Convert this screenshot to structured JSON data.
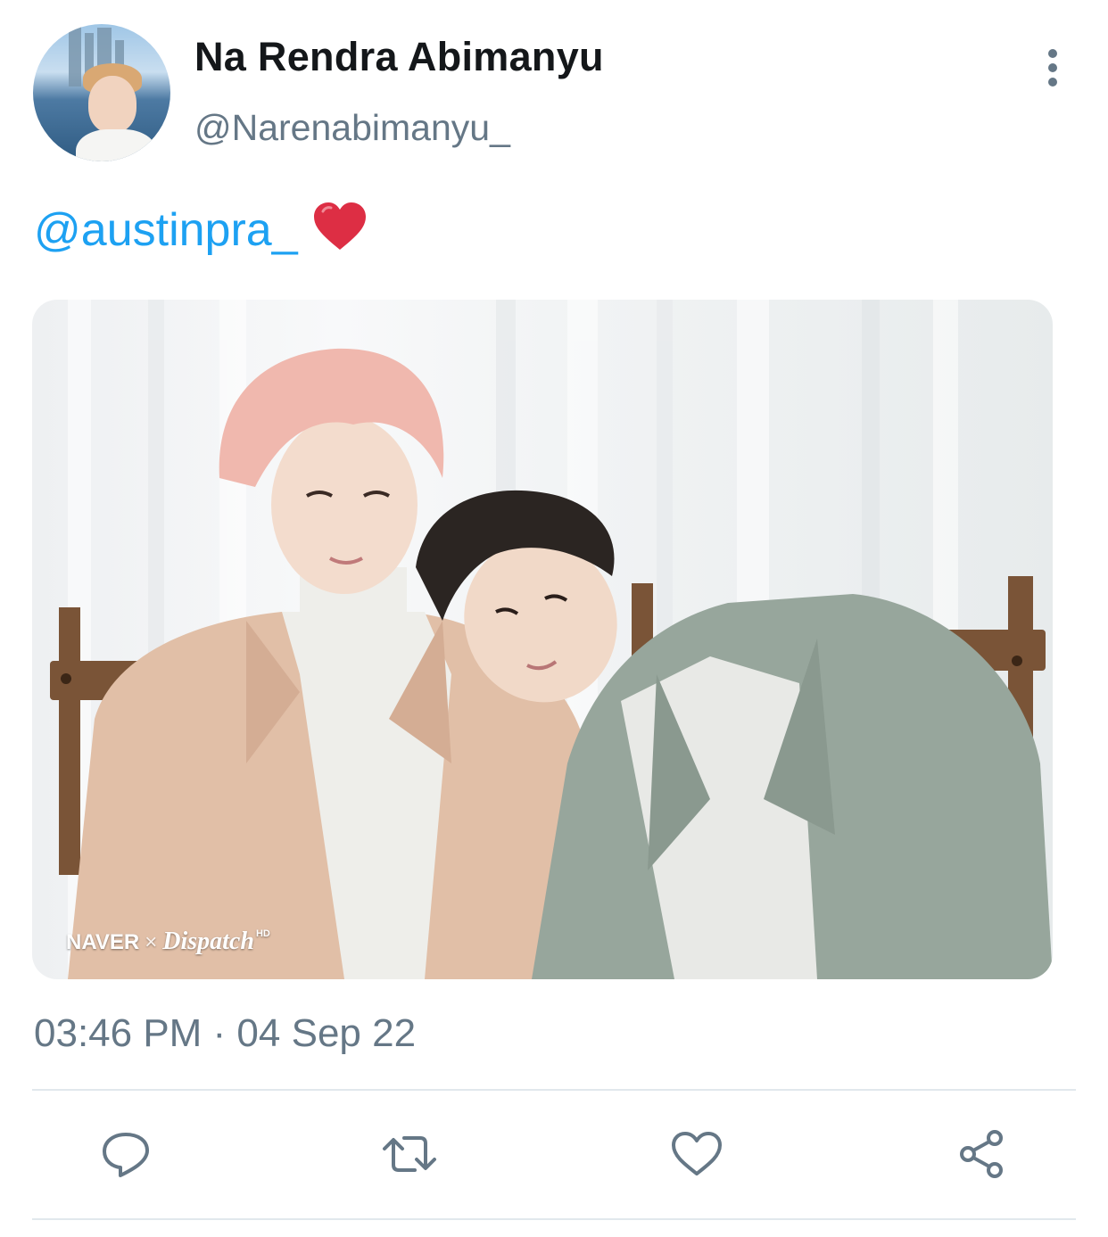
{
  "author": {
    "display_name": "Na Rendra Abimanyu",
    "handle": "@Narenabimanyu_"
  },
  "tweet": {
    "mention": "@austinpra_",
    "emoji": "heart-emoji",
    "media_watermark": {
      "brand_1": "NAVER",
      "separator": "×",
      "brand_2": "Dispatch",
      "badge": "HD"
    },
    "timestamp": "03:46 PM · 04 Sep 22"
  },
  "actions": [
    {
      "name": "reply",
      "icon": "reply-icon"
    },
    {
      "name": "retweet",
      "icon": "retweet-icon"
    },
    {
      "name": "like",
      "icon": "heart-outline-icon"
    },
    {
      "name": "share",
      "icon": "share-icon"
    }
  ],
  "colors": {
    "link": "#1da1f2",
    "secondary_text": "#657786",
    "primary_text": "#14171a",
    "divider": "#e1e8ed",
    "heart": "#e0245e"
  }
}
